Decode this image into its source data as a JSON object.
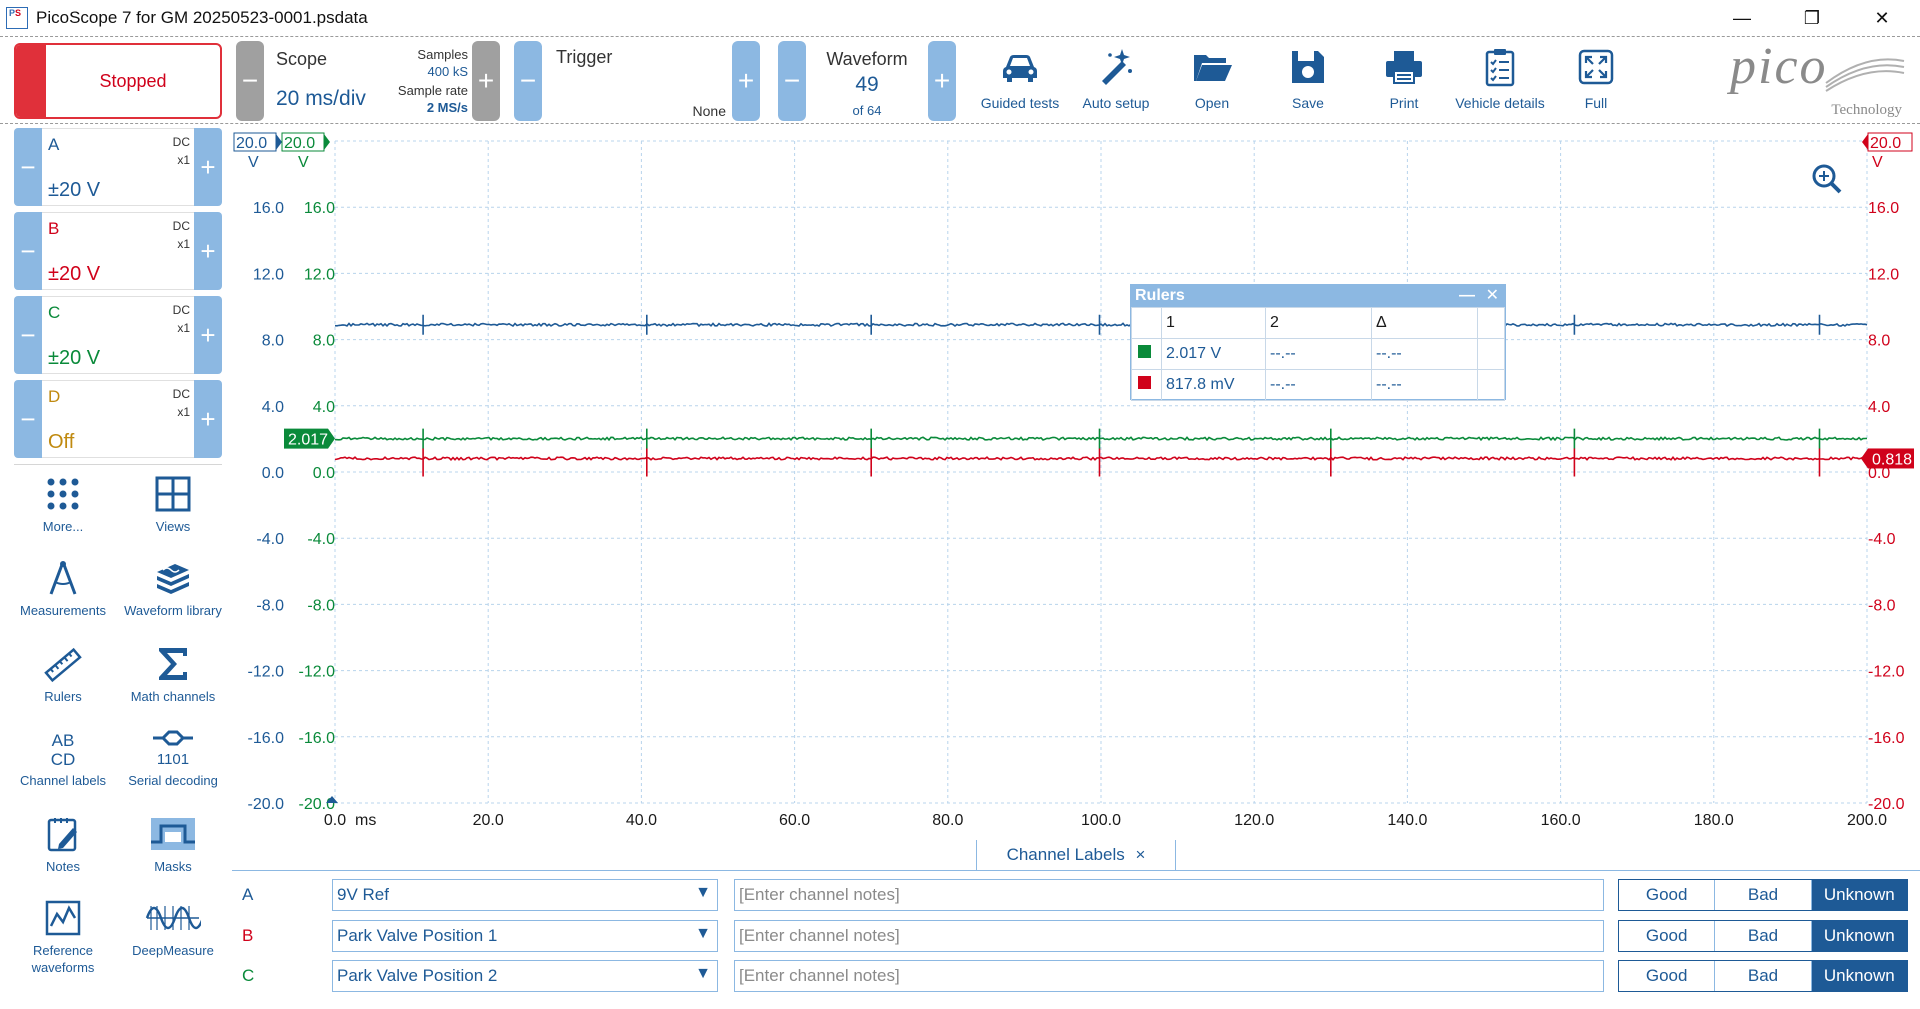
{
  "window": {
    "title": "PicoScope 7 for GM 20250523-0001.psdata",
    "icon": "PS"
  },
  "toolbar": {
    "run_state": "Stopped",
    "scope": {
      "title": "Scope",
      "timebase": "20 ms/div",
      "samples_label": "Samples",
      "samples_value": "400 kS",
      "rate_label": "Sample rate",
      "rate_value": "2 MS/s"
    },
    "trigger": {
      "title": "Trigger",
      "mode": "None"
    },
    "waveform": {
      "title": "Waveform",
      "current": "49",
      "total": "of 64"
    },
    "tools": {
      "guided_tests": "Guided tests",
      "auto_setup": "Auto setup",
      "open": "Open",
      "save": "Save",
      "print": "Print",
      "vehicle_details": "Vehicle details",
      "full": "Full"
    },
    "logo": {
      "word": "pico",
      "sub": "Technology"
    }
  },
  "channels": [
    {
      "letter": "A",
      "coupling": "DC",
      "probe": "x1",
      "range": "±20 V",
      "color": "#1e5a96"
    },
    {
      "letter": "B",
      "coupling": "DC",
      "probe": "x1",
      "range": "±20 V",
      "color": "#d0021b"
    },
    {
      "letter": "C",
      "coupling": "DC",
      "probe": "x1",
      "range": "±20 V",
      "color": "#0a8a3a"
    },
    {
      "letter": "D",
      "coupling": "DC",
      "probe": "x1",
      "range": "Off",
      "color": "#c08a10"
    }
  ],
  "side_tools": {
    "more": "More...",
    "views": "Views",
    "measurements": "Measurements",
    "waveform_library": "Waveform library",
    "rulers": "Rulers",
    "math_channels": "Math channels",
    "channel_labels": "Channel labels",
    "serial_decoding": "Serial decoding",
    "notes": "Notes",
    "masks": "Masks",
    "reference_waveforms": "Reference waveforms",
    "deepmeasure": "DeepMeasure"
  },
  "chart_data": {
    "type": "line",
    "xlabel": "ms",
    "xlim": [
      0,
      200
    ],
    "x_ticks": [
      "0.0",
      "20.0",
      "40.0",
      "60.0",
      "80.0",
      "100.0",
      "120.0",
      "140.0",
      "160.0",
      "180.0",
      "200.0"
    ],
    "ylim": [
      -20,
      20
    ],
    "y_ticks": [
      "20.0",
      "16.0",
      "12.0",
      "8.0",
      "4.0",
      "0.0",
      "-4.0",
      "-8.0",
      "-12.0",
      "-16.0",
      "-20.0"
    ],
    "axis_tops": {
      "a": "20.0",
      "c": "20.0",
      "b": "20.0",
      "unit": "V"
    },
    "grid": true,
    "series": [
      {
        "name": "A",
        "color": "#1e5a96",
        "level": 8.9
      },
      {
        "name": "C",
        "color": "#0a8a3a",
        "level": 2.017
      },
      {
        "name": "B",
        "color": "#d0021b",
        "level": 0.818
      }
    ],
    "spikes_ms": [
      11.5,
      40.7,
      70,
      99.8,
      130,
      161.8,
      193.8
    ],
    "markers": {
      "c_level_label": "2.017",
      "b_level_label": "0.818"
    }
  },
  "rulers": {
    "title": "Rulers",
    "col1": "1",
    "col2": "2",
    "col_delta": "Δ",
    "rows": [
      {
        "color": "#0a8a3a",
        "v1": "2.017 V",
        "v2": "--.--",
        "vd": "--.--"
      },
      {
        "color": "#d0021b",
        "v1": "817.8 mV",
        "v2": "--.--",
        "vd": "--.--"
      }
    ]
  },
  "channel_labels": {
    "tab_title": "Channel Labels",
    "notes_placeholder": "[Enter channel notes]",
    "good": "Good",
    "bad": "Bad",
    "unknown": "Unknown",
    "rows": [
      {
        "letter": "A",
        "label": "9V Ref",
        "color": "#1e5a96"
      },
      {
        "letter": "B",
        "label": "Park Valve Position 1",
        "color": "#d0021b"
      },
      {
        "letter": "C",
        "label": "Park Valve Position 2",
        "color": "#0a8a3a"
      }
    ]
  }
}
